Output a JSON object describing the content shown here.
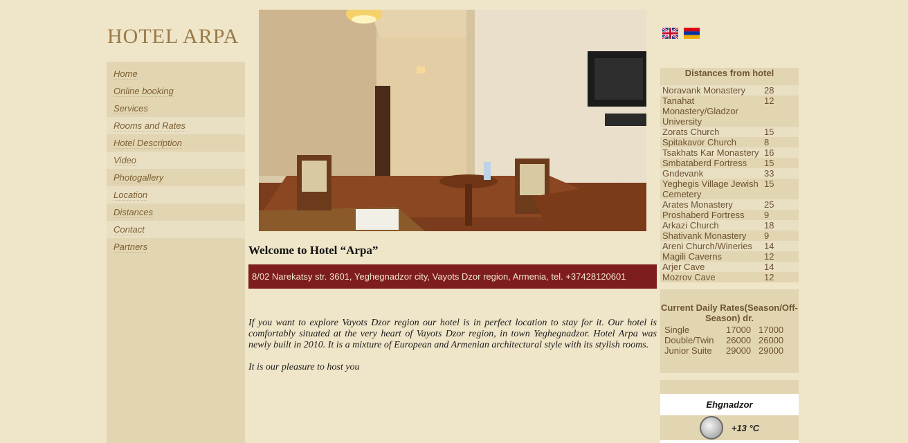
{
  "site": {
    "logo": "HOTEL ARPA"
  },
  "nav": [
    {
      "label": "Home"
    },
    {
      "label": "Online booking"
    },
    {
      "label": "Services"
    },
    {
      "label": "Rooms and Rates"
    },
    {
      "label": "Hotel Description"
    },
    {
      "label": "Video"
    },
    {
      "label": "Photogallery"
    },
    {
      "label": "Location"
    },
    {
      "label": "Distances"
    },
    {
      "label": "Contact"
    },
    {
      "label": "Partners"
    }
  ],
  "main": {
    "welcome": "Welcome to Hotel “Arpa”",
    "address": "8/02 Narekatsy str. 3601, Yeghegnadzor city, Vayots Dzor region, Armenia, tel. +37428120601",
    "paragraph1": "If you want to explore Vayots Dzor region our hotel is in perfect location to stay for it. Our hotel is comfortably situated at the very heart of Vayots Dzor region, in town Yeghegnadzor. Hotel Arpa was newly built in 2010. It is a mixture of European and Armenian architectural style with its stylish rooms.",
    "paragraph2": "It is our pleasure to host you"
  },
  "flags": [
    {
      "name": "english-flag-icon"
    },
    {
      "name": "armenian-flag-icon"
    }
  ],
  "distances": {
    "title": "Distances from hotel",
    "rows": [
      {
        "name": "Noravank Monastery",
        "km": "28"
      },
      {
        "name": "Tanahat Monastery/Gladzor University",
        "km": "12"
      },
      {
        "name": "Zorats Church",
        "km": "15"
      },
      {
        "name": "Spitakavor Church",
        "km": "8"
      },
      {
        "name": "Tsakhats Kar Monastery",
        "km": "16"
      },
      {
        "name": "Smbataberd Fortress",
        "km": "15"
      },
      {
        "name": "Gndevank",
        "km": "33"
      },
      {
        "name": "Yeghegis Village Jewish Cemetery",
        "km": "15"
      },
      {
        "name": "Arates Monastery",
        "km": "25"
      },
      {
        "name": "Proshaberd Fortress",
        "km": "9"
      },
      {
        "name": "Arkazi Church",
        "km": "18"
      },
      {
        "name": "Shativank Monastery",
        "km": "9"
      },
      {
        "name": "Areni Church/Wineries",
        "km": "14"
      },
      {
        "name": "Magili Caverns",
        "km": "12"
      },
      {
        "name": "Arjer Cave",
        "km": "14"
      },
      {
        "name": "Mozrov Cave",
        "km": "12"
      }
    ]
  },
  "rates": {
    "title": "Current Daily Rates(Season/Off-Season) dr.",
    "rows": [
      {
        "name": "Single",
        "season": "17000",
        "offseason": "17000"
      },
      {
        "name": "Double/Twin",
        "season": "26000",
        "offseason": "26000"
      },
      {
        "name": "Junior Suite",
        "season": "29000",
        "offseason": "29000"
      }
    ]
  },
  "weather": {
    "city": "Ehgnadzor",
    "temp": "+13 °C",
    "icon": "moon-icon"
  }
}
